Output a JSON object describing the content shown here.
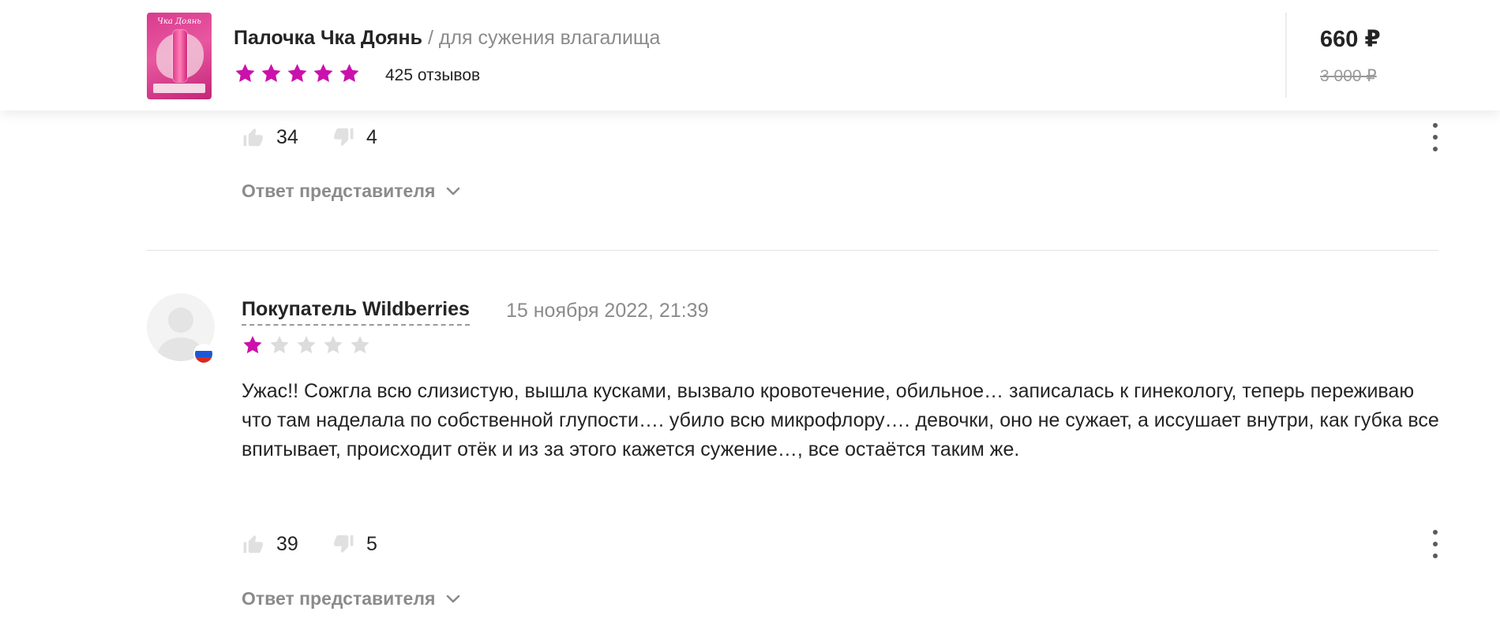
{
  "product": {
    "name": "Палочка Чка Доянь",
    "separator": "/",
    "subtitle": "для сужения влагалища",
    "rating_stars": 5,
    "reviews_count": "425 отзывов",
    "price_current": "660 ₽",
    "price_old": "3 000 ₽",
    "thumb_label": "Чка Доянь"
  },
  "colors": {
    "accent_star": "#cb11ab",
    "empty_star": "#dcdcdc",
    "muted_text": "#8b8b8b",
    "flag_white": "#ffffff",
    "flag_blue": "#1c57d6",
    "flag_red": "#d52b1e"
  },
  "previous_review": {
    "likes": "34",
    "dislikes": "4",
    "seller_reply_label": "Ответ представителя"
  },
  "review": {
    "author": "Покупатель Wildberries",
    "date": "15 ноября 2022, 21:39",
    "rating": 1,
    "max_rating": 5,
    "text": "Ужас!! Сожгла всю слизистую, вышла кусками, вызвало кровотечение, обильное… записалась к гинекологу, теперь переживаю что там наделала по собственной глупости…. убило всю микрофлору…. девочки, оно не сужает, а иссушает внутри, как губка все впитывает, происходит отёк и из за этого кажется сужение…, все остаётся таким же.",
    "likes": "39",
    "dislikes": "5",
    "seller_reply_label": "Ответ представителя",
    "author_country_icon": "russia-flag-icon"
  },
  "icons": {
    "like": "thumbs-up-icon",
    "dislike": "thumbs-down-icon",
    "more": "more-vertical-icon",
    "expand": "chevron-down-icon",
    "star": "star-icon",
    "avatar": "user-avatar-icon"
  }
}
